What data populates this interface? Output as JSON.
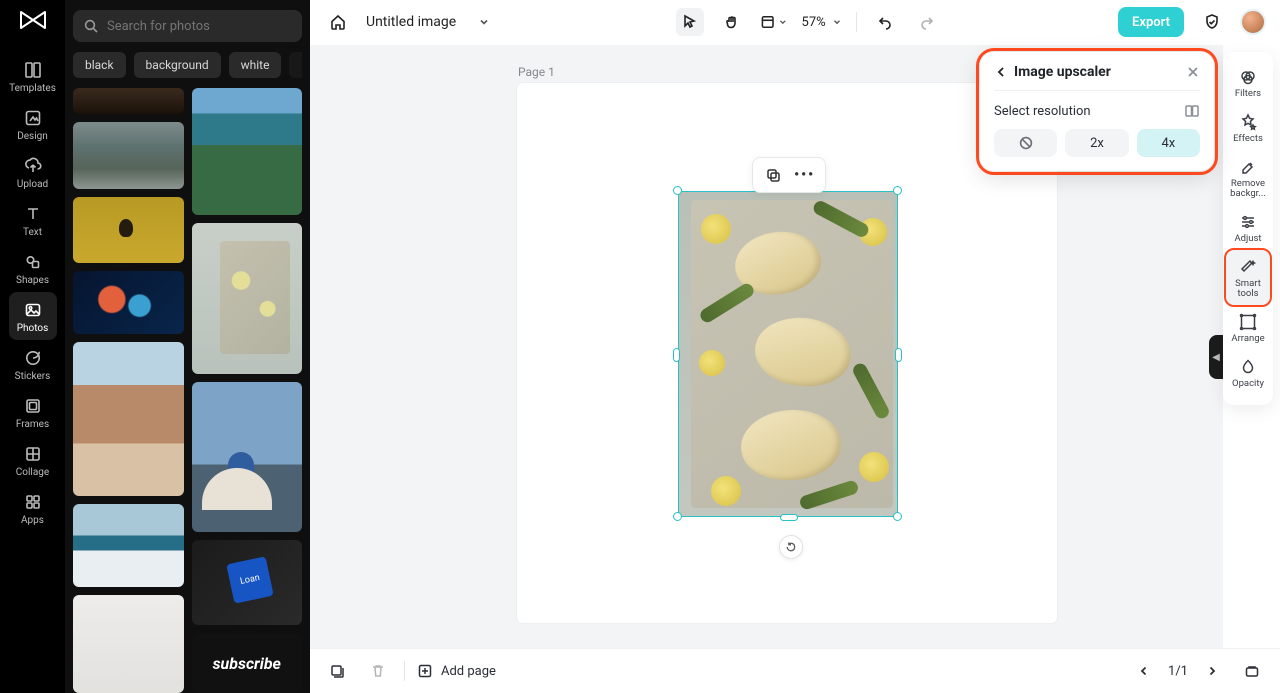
{
  "app": {
    "title": "Untitled image",
    "zoom": "57%",
    "export_label": "Export"
  },
  "search": {
    "placeholder": "Search for photos"
  },
  "chips": [
    "black",
    "background",
    "white"
  ],
  "rail": {
    "templates": "Templates",
    "design": "Design",
    "upload": "Upload",
    "text": "Text",
    "shapes": "Shapes",
    "photos": "Photos",
    "stickers": "Stickers",
    "frames": "Frames",
    "collage": "Collage",
    "apps": "Apps"
  },
  "right_rail": {
    "filters": "Filters",
    "effects": "Effects",
    "removebg": "Remove backgr...",
    "adjust": "Adjust",
    "smart": "Smart tools",
    "arrange": "Arrange",
    "opacity": "Opacity"
  },
  "canvas": {
    "page_label": "Page 1"
  },
  "upscaler": {
    "title": "Image upscaler",
    "select_res": "Select resolution",
    "btn_2x": "2x",
    "btn_4x": "4x"
  },
  "bottom": {
    "add_page": "Add page",
    "pager": "1/1"
  },
  "thumb_subscribe": "subscribe"
}
